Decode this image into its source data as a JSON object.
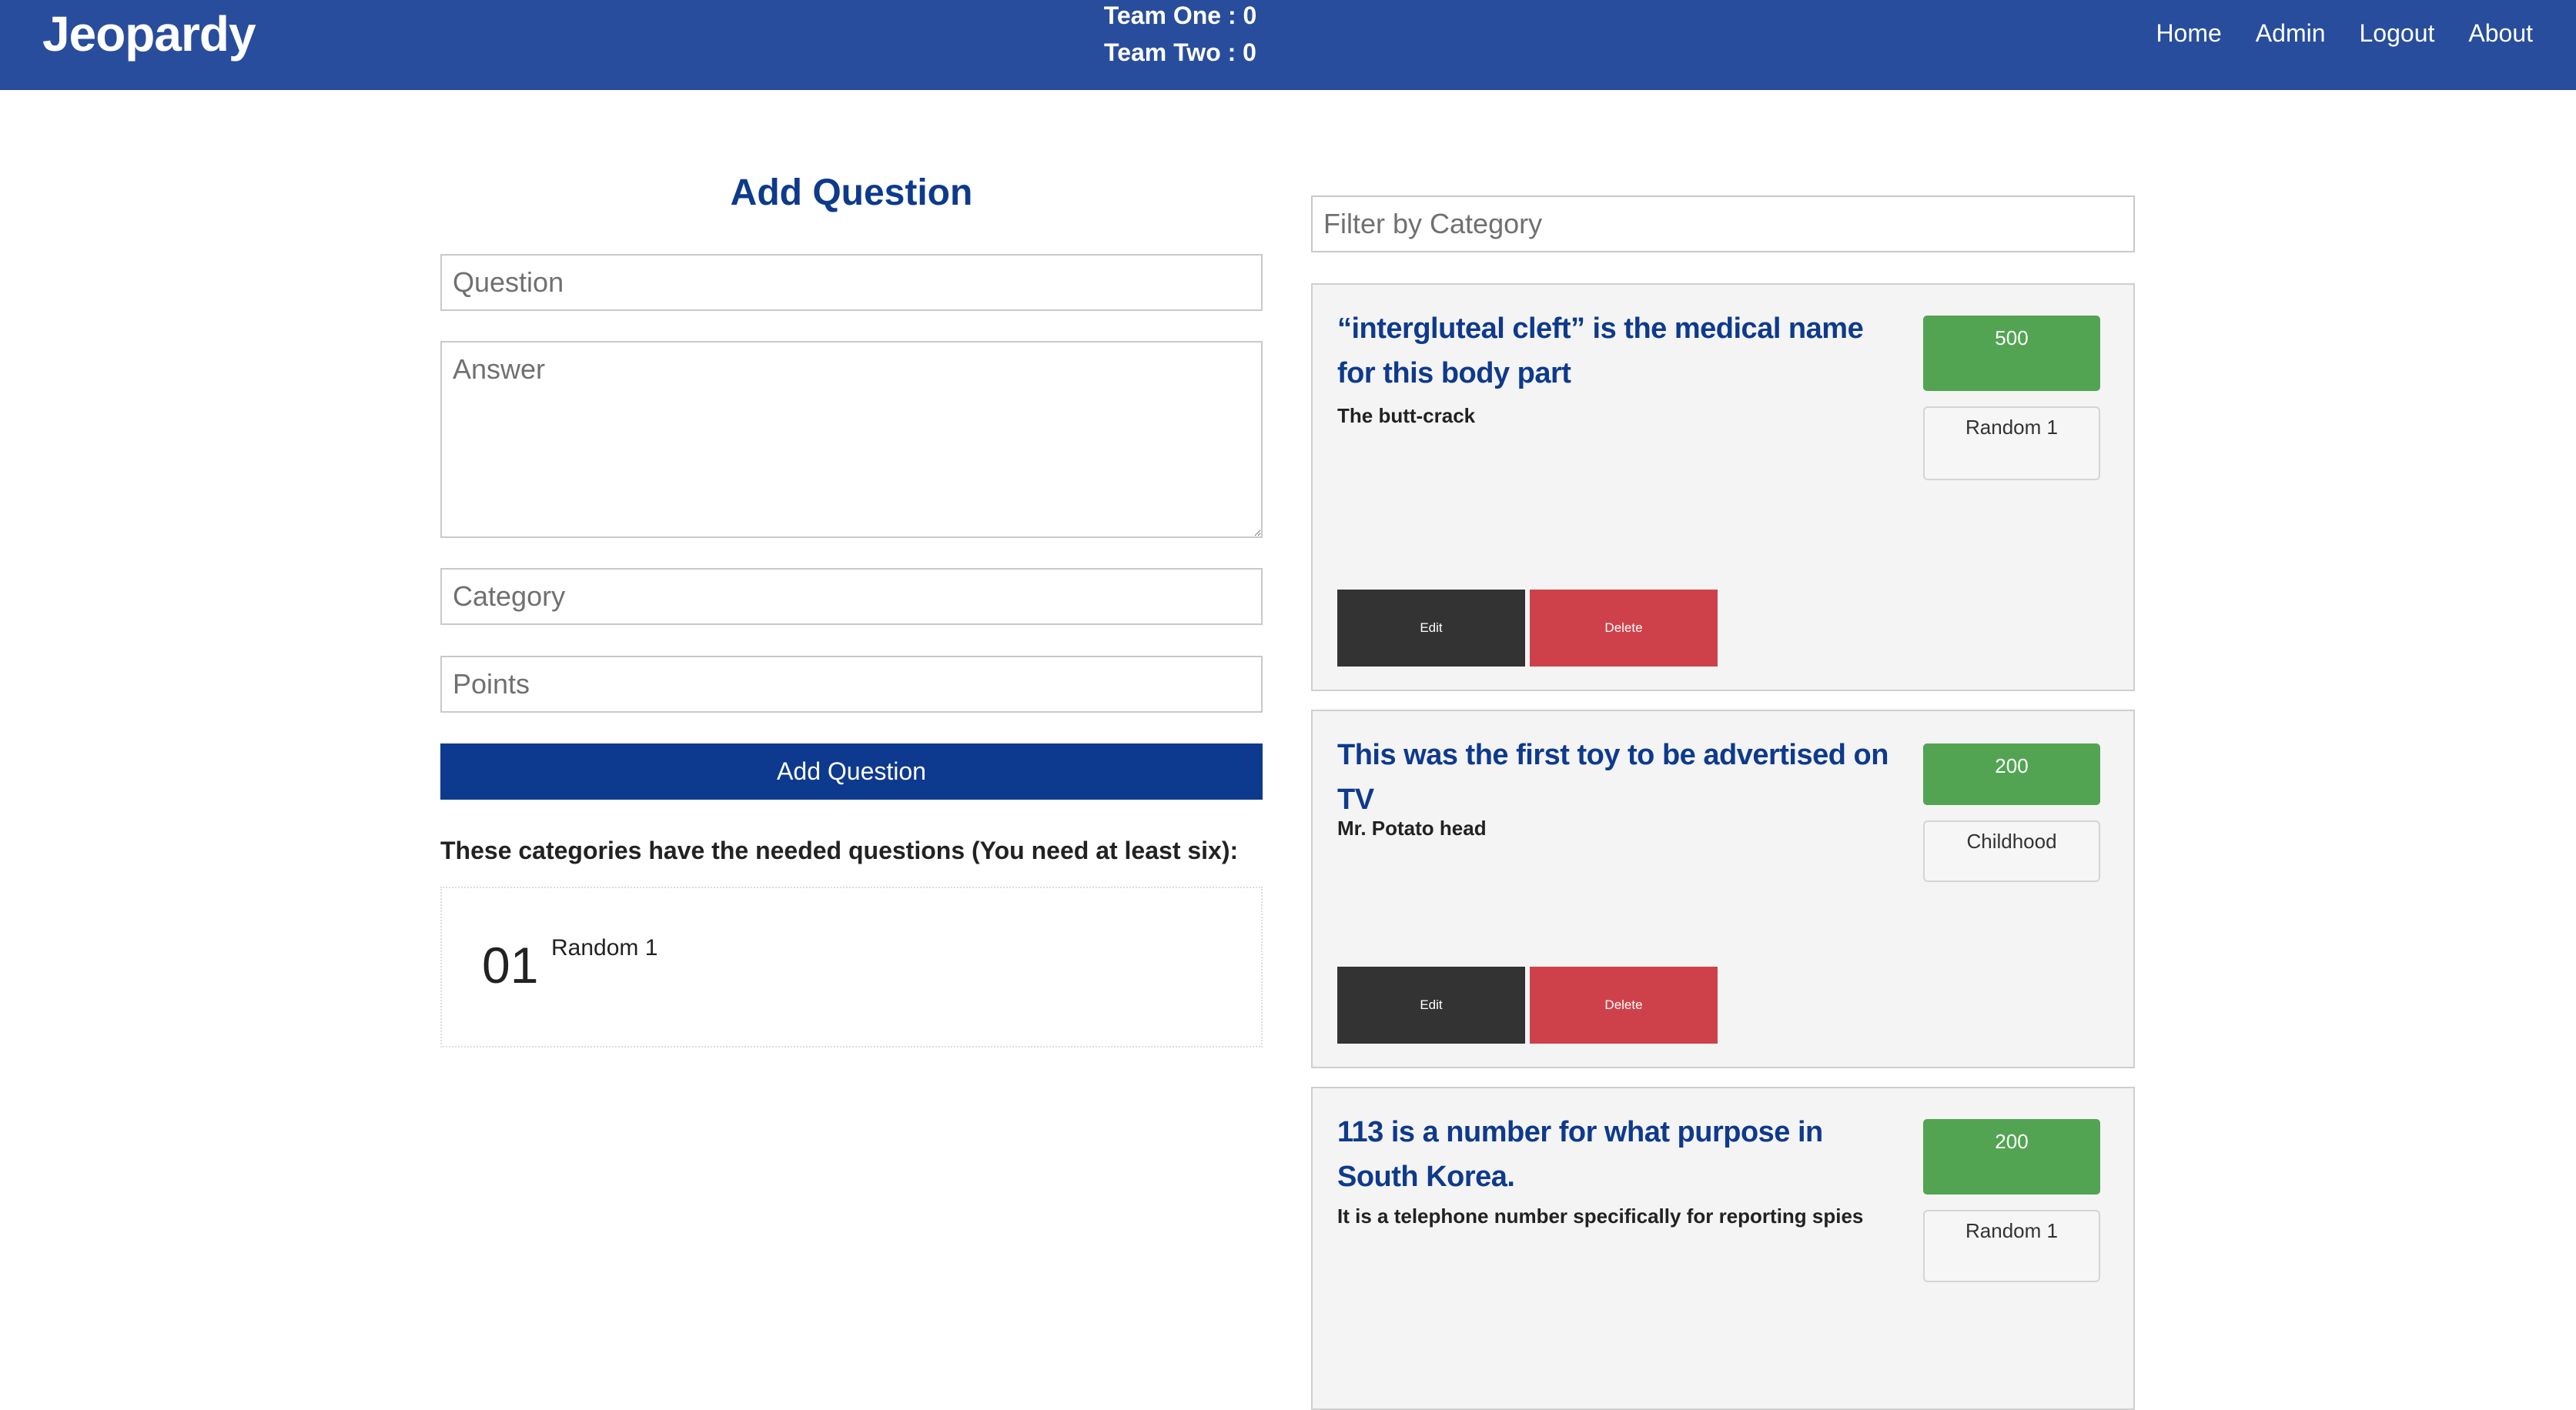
{
  "nav": {
    "brand": "Jeopardy",
    "team_one": "Team One : 0",
    "team_two": "Team Two : 0",
    "links": [
      "Home",
      "Admin",
      "Logout",
      "About"
    ]
  },
  "form": {
    "title": "Add Question",
    "question_placeholder": "Question",
    "answer_placeholder": "Answer",
    "category_placeholder": "Category",
    "points_placeholder": "Points",
    "submit_label": "Add Question"
  },
  "categories_note": "These categories have the needed questions (You need at least six):",
  "categories": [
    {
      "number": "01",
      "name": "Random 1"
    }
  ],
  "filter": {
    "placeholder": "Filter by Category"
  },
  "cards": [
    {
      "question": "“intergluteal cleft” is the medical name for this body part",
      "answer": "The butt-crack",
      "points": "500",
      "category": "Random 1",
      "edit_label": "Edit",
      "delete_label": "Delete"
    },
    {
      "question": "This was the first toy to be advertised on TV",
      "answer": "Mr. Potato head",
      "points": "200",
      "category": "Childhood",
      "edit_label": "Edit",
      "delete_label": "Delete"
    },
    {
      "question": "113 is a number for what purpose in South Korea.",
      "answer": "It is a telephone number specifically for reporting spies",
      "points": "200",
      "category": "Random 1"
    }
  ],
  "colors": {
    "navbar": "#284d9c",
    "primary": "#0d3a8e",
    "title_blue": "#0e3a8c",
    "points_green": "#52a452",
    "edit_dark": "#333333",
    "delete_red": "#cf414a",
    "card_bg": "#f4f4f4"
  }
}
